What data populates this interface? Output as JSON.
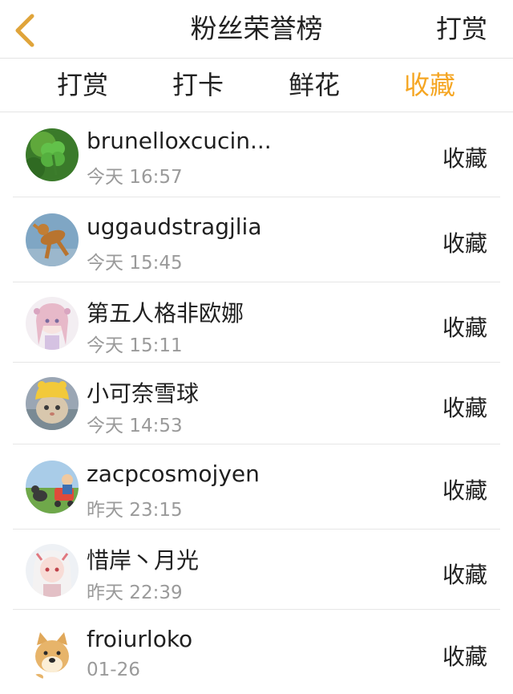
{
  "nav": {
    "title": "粉丝荣誉榜",
    "right_label": "打赏",
    "back_icon": "chevron-left-icon",
    "back_color": "#e0a43a"
  },
  "tabs": [
    {
      "label": "打赏",
      "active": false
    },
    {
      "label": "打卡",
      "active": false
    },
    {
      "label": "鲜花",
      "active": false
    },
    {
      "label": "收藏",
      "active": true
    }
  ],
  "accent_color": "#f5a623",
  "list": [
    {
      "name": "brunelloxcucin...",
      "time": "今天 16:57",
      "action": "收藏",
      "avatar": "clover-avatar"
    },
    {
      "name": "uggaudstragjlia",
      "time": "今天 15:45",
      "action": "收藏",
      "avatar": "dog-jumping-avatar"
    },
    {
      "name": "第五人格非欧娜",
      "time": "今天 15:11",
      "action": "收藏",
      "avatar": "anime-girl-avatar"
    },
    {
      "name": "小可奈雪球",
      "time": "今天 14:53",
      "action": "收藏",
      "avatar": "cat-yellow-hat-avatar"
    },
    {
      "name": "zacpcosmojyen",
      "time": "昨天 23:15",
      "action": "收藏",
      "avatar": "kids-outdoor-avatar"
    },
    {
      "name": "惜岸丶月光",
      "time": "昨天 22:39",
      "action": "收藏",
      "avatar": "anime-girl-white-avatar"
    },
    {
      "name": "froiurloko",
      "time": "01-26",
      "action": "收藏",
      "avatar": "doge-avatar"
    }
  ]
}
